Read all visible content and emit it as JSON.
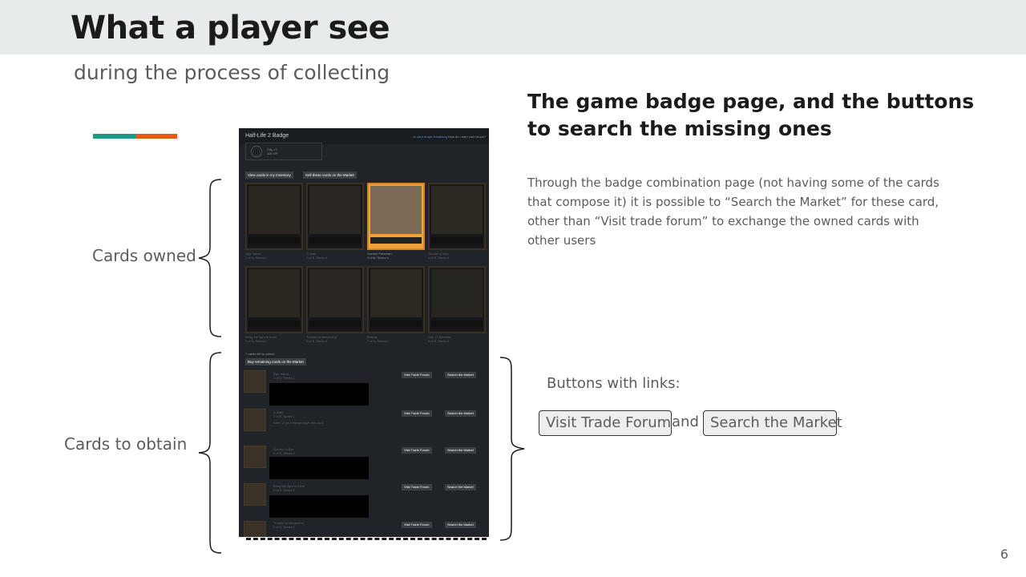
{
  "slide": {
    "title": "What a player see",
    "subtitle": "during the process of collecting",
    "page_number": "6",
    "accent_colors": [
      "#1e9a84",
      "#e35a12"
    ]
  },
  "labels": {
    "cards_owned": "Cards owned",
    "cards_to_obtain": "Cards to obtain"
  },
  "section": {
    "title": "The game badge page, and the buttons to search the missing ones",
    "body": "Through the badge combination page (not having some of the cards that compose it) it is possible to “Search the Market” for these card, other than “Visit trade forum” to exchange the owned cards with other users"
  },
  "buttons_section": {
    "label": "Buttons with links:",
    "visit_forum": "Visit Trade Forum",
    "and": "and",
    "search_market": "Search the Market"
  },
  "steam": {
    "title": "Half-Life 2 Badge",
    "header_links": {
      "no_drops": "no card drops remaining",
      "how_get": "How do I earn card drops?"
    },
    "badge": {
      "name": "City 17",
      "xp": "100 XP"
    },
    "view_inventory_button": "View cards in my Inventory",
    "sell_button": "Sell these cards on the Market",
    "cards": [
      {
        "name": "Alyx Vance",
        "count": "1 of 8, Series 1",
        "owned": false
      },
      {
        "name": "G-Man",
        "count": "2 of 8, Series 1",
        "owned": false
      },
      {
        "name": "Gordon Freeman",
        "count": "3 of 8, Series 1",
        "owned": true
      },
      {
        "name": "Gordon & Alyx",
        "count": "4 of 8, Series 1",
        "owned": false
      },
      {
        "name": "Bring the fight to them",
        "count": "5 of 8, Series 1",
        "owned": false
      },
      {
        "name": "Trouble Underground",
        "count": "6 of 8, Series 1",
        "owned": false
      },
      {
        "name": "Rebels",
        "count": "7 of 8, Series 1",
        "owned": false
      },
      {
        "name": "City 17 Nemesis",
        "count": "8 of 8, Series 1",
        "owned": false
      }
    ],
    "cards_left": "7 cards left to collect",
    "buy_remaining": "Buy remaining cards on the Market",
    "row_buttons": {
      "forum": "Visit Trade Forum",
      "market": "Search the Market"
    },
    "missing": [
      {
        "name": "Alyx Vance",
        "count": "1 of 8, Series 1",
        "note": ""
      },
      {
        "name": "G-Man",
        "count": "2 of 8, Series 1",
        "note": "None of your friends have this card"
      },
      {
        "name": "Gordon & Alyx",
        "count": "4 of 8, Series 1",
        "note": ""
      },
      {
        "name": "Bring the fight to them",
        "count": "5 of 8, Series 1",
        "note": ""
      },
      {
        "name": "Trouble Underground",
        "count": "6 of 8, Series 1",
        "note": ""
      }
    ]
  }
}
